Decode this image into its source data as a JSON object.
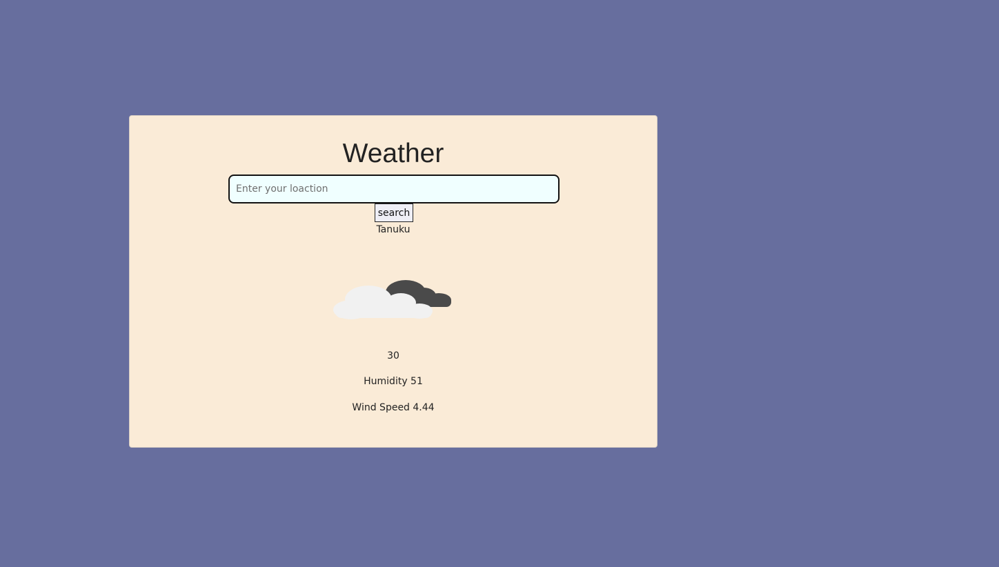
{
  "app": {
    "title": "Weather"
  },
  "search": {
    "placeholder": "Enter your loaction",
    "value": "",
    "button_label": "search"
  },
  "weather": {
    "city": "Tanuku",
    "icon": "clouds-icon",
    "temperature": "30",
    "humidity_text": "Humidity 51",
    "wind_text": "Wind Speed 4.44"
  },
  "colors": {
    "page_background": "#676e9e",
    "card_background": "#faebd7",
    "input_background": "#f0ffff"
  }
}
